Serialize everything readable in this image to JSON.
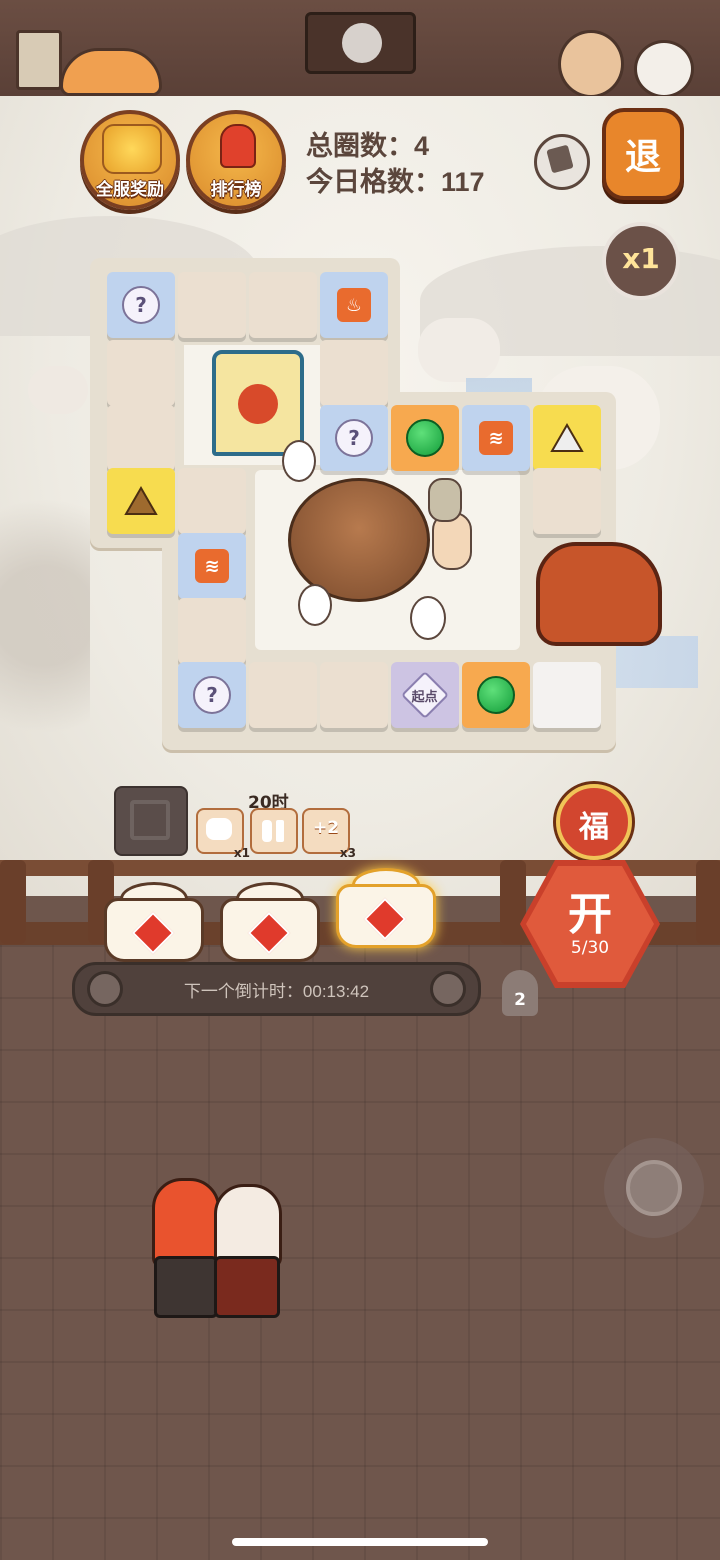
{
  "buttons": {
    "server_reward_label": "全服奖励",
    "ranking_label": "排行榜",
    "exit_label": "退",
    "speed_label": "x1",
    "fortune_label": "福",
    "open_label": "开",
    "open_count": "5/30"
  },
  "stats": {
    "total_laps": "总圈数：4",
    "today_tiles": "今日格数：117"
  },
  "board": {
    "start_label": "起点"
  },
  "items": {
    "timer_label": "20时",
    "horse_mult": "x1",
    "bonus_label": "+2",
    "bonus_mult": "x3"
  },
  "countdown": {
    "label": "下一个倒计时：00:13:42"
  },
  "ghost_count": "2",
  "colors": {
    "accent_gold": "#f5b84b",
    "accent_red": "#e05a3c",
    "tile_blue": "#bfd3ee",
    "tile_orange": "#f7a94f",
    "tile_yellow": "#f7dc4f"
  }
}
